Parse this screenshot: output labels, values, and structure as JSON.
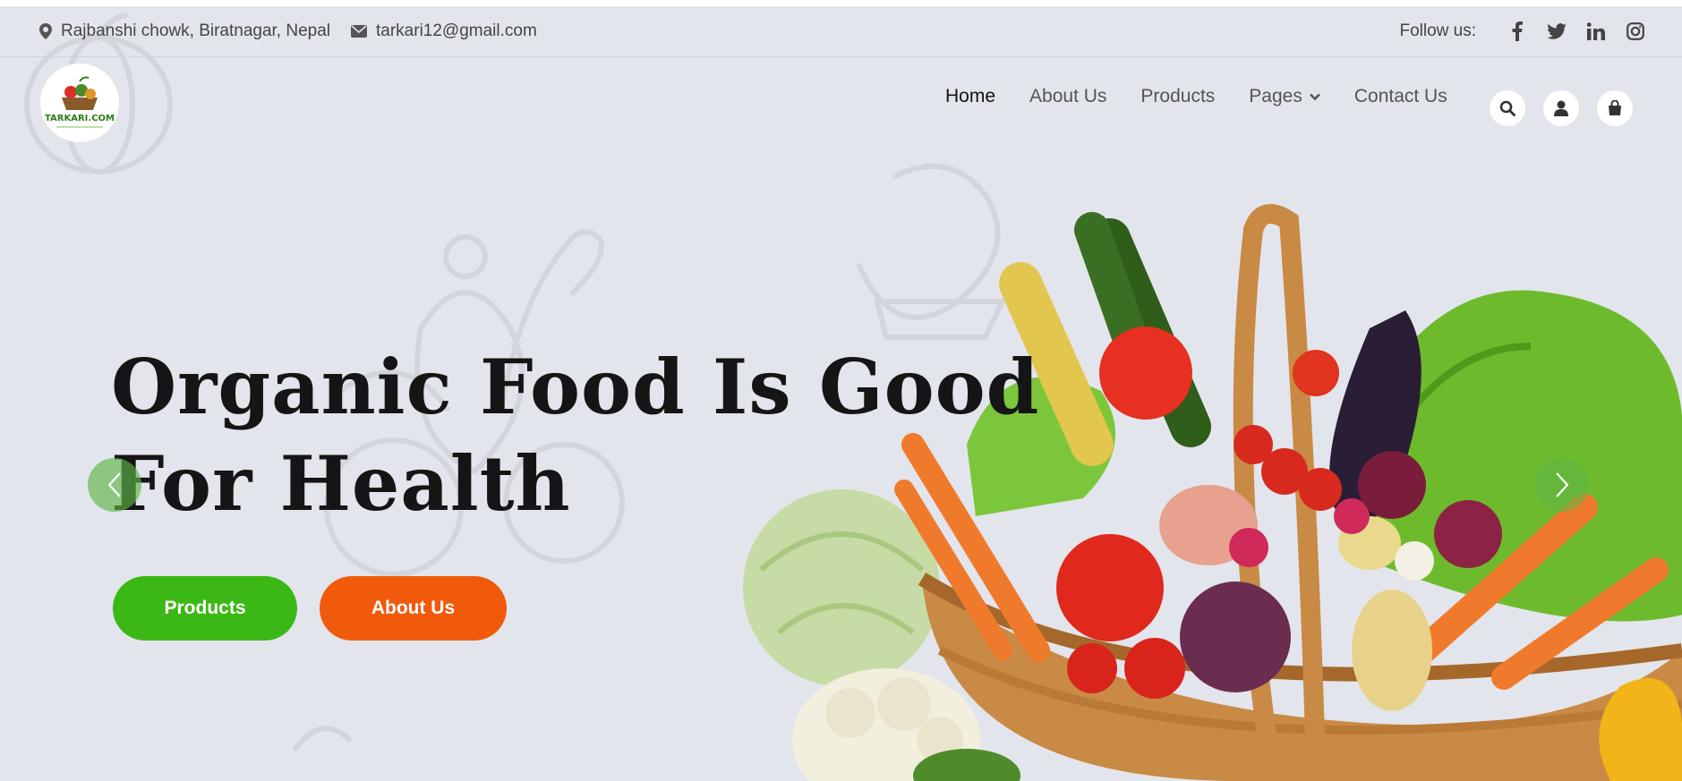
{
  "topbar": {
    "address": "Rajbanshi chowk, Biratnagar, Nepal",
    "email": "tarkari12@gmail.com",
    "follow_label": "Follow us:",
    "social": [
      {
        "name": "facebook-icon",
        "glyph": "f"
      },
      {
        "name": "twitter-icon",
        "glyph": "t"
      },
      {
        "name": "linkedin-icon",
        "glyph": "in"
      },
      {
        "name": "instagram-icon",
        "glyph": "ig"
      }
    ]
  },
  "header": {
    "logo_text": "TARKARI.COM",
    "nav": [
      {
        "label": "Home",
        "active": true
      },
      {
        "label": "About Us"
      },
      {
        "label": "Products"
      },
      {
        "label": "Pages",
        "dropdown": true
      },
      {
        "label": "Contact Us"
      }
    ],
    "icons": [
      "search-icon",
      "user-icon",
      "cart-icon"
    ]
  },
  "hero": {
    "title_line1": "Organic Food Is Good",
    "title_line2": "For Health",
    "primary_button": "Products",
    "secondary_button": "About Us",
    "colors": {
      "primary": "#3cb816",
      "secondary": "#f15a0a",
      "background": "#e3e5ec"
    }
  }
}
